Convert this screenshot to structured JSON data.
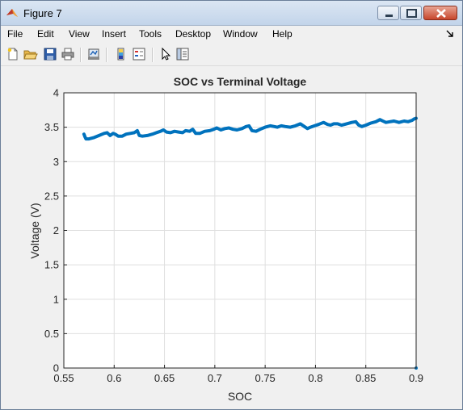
{
  "window": {
    "title": "Figure 7",
    "icon": "matlab-logo-icon",
    "controls": [
      "minimize-icon",
      "maximize-icon",
      "close-icon"
    ]
  },
  "menu": {
    "items": [
      "File",
      "Edit",
      "View",
      "Insert",
      "Tools",
      "Desktop",
      "Window",
      "Help"
    ],
    "dock_icon": "dock-arrow-icon"
  },
  "toolbar": {
    "icons": [
      "new-figure-icon",
      "open-file-icon",
      "save-icon",
      "print-icon",
      "link-plot-icon",
      "colorbar-icon",
      "legend-icon",
      "pointer-icon",
      "property-editor-icon"
    ]
  },
  "colors": {
    "line": "#0072bd",
    "axes_bg": "#ffffff",
    "figure_bg": "#f0f0f0",
    "grid": "#dfdfdf"
  },
  "chart_data": {
    "type": "line",
    "title": "SOC vs Terminal Voltage",
    "xlabel": "SOC",
    "ylabel": "Voltage (V)",
    "xlim": [
      0.55,
      0.9
    ],
    "ylim": [
      0,
      4
    ],
    "xticks": [
      "0.55",
      "0.6",
      "0.65",
      "0.7",
      "0.75",
      "0.8",
      "0.85",
      "0.9"
    ],
    "yticks": [
      "0",
      "0.5",
      "1",
      "1.5",
      "2",
      "2.5",
      "3",
      "3.5",
      "4"
    ],
    "grid": true,
    "series": [
      {
        "x": [
          0.57,
          0.571,
          0.572,
          0.575,
          0.58,
          0.585,
          0.59,
          0.593,
          0.596,
          0.599,
          0.601,
          0.604,
          0.608,
          0.612,
          0.616,
          0.62,
          0.623,
          0.625,
          0.628,
          0.633,
          0.638,
          0.642,
          0.646,
          0.649,
          0.652,
          0.656,
          0.66,
          0.664,
          0.668,
          0.671,
          0.675,
          0.678,
          0.681,
          0.685,
          0.69,
          0.695,
          0.699,
          0.702,
          0.706,
          0.71,
          0.714,
          0.718,
          0.722,
          0.727,
          0.731,
          0.734,
          0.737,
          0.741,
          0.745,
          0.75,
          0.755,
          0.759,
          0.762,
          0.766,
          0.77,
          0.775,
          0.78,
          0.785,
          0.789,
          0.792,
          0.795,
          0.799,
          0.803,
          0.808,
          0.812,
          0.815,
          0.818,
          0.822,
          0.826,
          0.831,
          0.836,
          0.84,
          0.843,
          0.846,
          0.85,
          0.855,
          0.86,
          0.864,
          0.867,
          0.87,
          0.874,
          0.878,
          0.883,
          0.888,
          0.892,
          0.896,
          0.898,
          0.9
        ],
        "y": [
          3.4,
          3.36,
          3.33,
          3.33,
          3.35,
          3.38,
          3.41,
          3.42,
          3.38,
          3.41,
          3.4,
          3.37,
          3.37,
          3.4,
          3.41,
          3.42,
          3.45,
          3.38,
          3.37,
          3.38,
          3.4,
          3.42,
          3.44,
          3.46,
          3.43,
          3.42,
          3.44,
          3.43,
          3.42,
          3.45,
          3.44,
          3.47,
          3.41,
          3.41,
          3.44,
          3.45,
          3.47,
          3.49,
          3.46,
          3.48,
          3.49,
          3.47,
          3.46,
          3.48,
          3.51,
          3.52,
          3.45,
          3.44,
          3.47,
          3.5,
          3.52,
          3.51,
          3.5,
          3.52,
          3.51,
          3.5,
          3.52,
          3.55,
          3.51,
          3.48,
          3.5,
          3.52,
          3.54,
          3.57,
          3.54,
          3.53,
          3.55,
          3.55,
          3.53,
          3.55,
          3.57,
          3.58,
          3.53,
          3.51,
          3.53,
          3.56,
          3.58,
          3.61,
          3.59,
          3.57,
          3.58,
          3.59,
          3.57,
          3.59,
          3.58,
          3.6,
          3.62,
          3.63
        ]
      }
    ],
    "outlier_point": {
      "x": 0.9,
      "y": 0
    }
  }
}
